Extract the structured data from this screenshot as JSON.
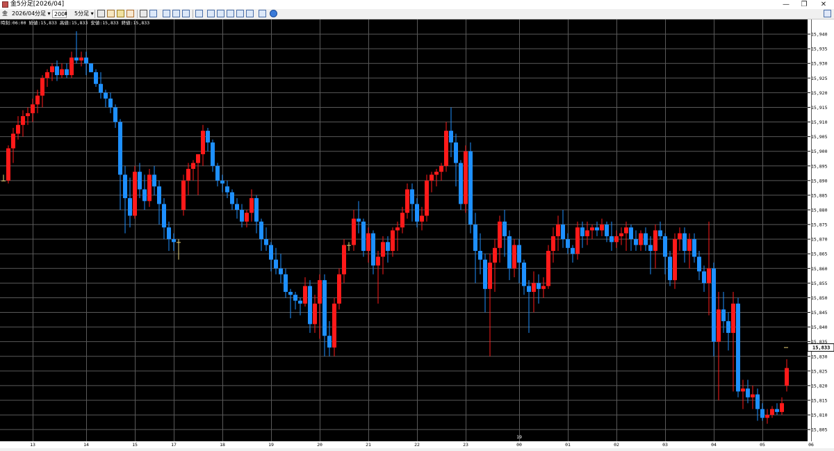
{
  "window": {
    "title": "金5分足[2026/04]",
    "controls": [
      "—",
      "❐",
      "✕"
    ]
  },
  "toolbar": {
    "symbol": "金",
    "contract": "2026/04",
    "period_unit": "分足",
    "bar_count": "200",
    "timeframe": "5分足",
    "icons": [
      "cursor-icon",
      "hand-icon",
      "pencil-icon",
      "line-icon",
      "crosshair-icon",
      "window-icon",
      "grid-icon",
      "table-icon",
      "indicator-icon",
      "bar-chart-icon",
      "bar-chart2-icon",
      "bar-chart3-icon",
      "bar-chart4-icon",
      "bar-chart5-icon",
      "refresh-icon",
      "settings-icon"
    ]
  },
  "info": {
    "time_label": "時刻:",
    "time": "06:00",
    "open_label": "始値:",
    "open": "15,833",
    "high_label": "高値:",
    "high": "15,833",
    "low_label": "安値:",
    "low": "15,833",
    "close_label": "終値:",
    "close": "15,833"
  },
  "colors": {
    "background": "#000000",
    "grid": "#5a5a5a",
    "up": "#ff1a1a",
    "down": "#1e90ff",
    "doji": "#e8d27a",
    "axis_bg": "#ffffff"
  },
  "chart_data": {
    "type": "candlestick",
    "y_range": [
      15801,
      15945
    ],
    "y_ticks": [
      15805,
      15810,
      15815,
      15820,
      15825,
      15830,
      15835,
      15840,
      15845,
      15850,
      15855,
      15860,
      15865,
      15870,
      15875,
      15880,
      15885,
      15890,
      15895,
      15900,
      15905,
      15910,
      15915,
      15920,
      15925,
      15930,
      15935,
      15940
    ],
    "current_price": 15833,
    "current_price_label": "15,833",
    "x_labels": [
      {
        "label": "13",
        "index": 6
      },
      {
        "label": "14",
        "index": 17
      },
      {
        "label": "15",
        "index": 27
      },
      {
        "label": "17",
        "index": 35
      },
      {
        "label": "18",
        "index": 45
      },
      {
        "label": "19",
        "index": 55
      },
      {
        "label": "20",
        "index": 65
      },
      {
        "label": "21",
        "index": 75
      },
      {
        "label": "22",
        "index": 85
      },
      {
        "label": "23",
        "index": 95
      },
      {
        "label": "00",
        "index": 106
      },
      {
        "label": "01",
        "index": 116
      },
      {
        "label": "02",
        "index": 126
      },
      {
        "label": "03",
        "index": 136
      },
      {
        "label": "04",
        "index": 146
      },
      {
        "label": "05",
        "index": 156
      },
      {
        "label": "06",
        "index": 166
      }
    ],
    "x_sublabel": {
      "label": "19",
      "index": 106
    },
    "candles": [
      [
        15890,
        15892,
        15890,
        15890
      ],
      [
        15890,
        15902,
        15889,
        15901
      ],
      [
        15901,
        15908,
        15896,
        15906
      ],
      [
        15906,
        15912,
        15904,
        15909
      ],
      [
        15909,
        15914,
        15905,
        15912
      ],
      [
        15912,
        15915,
        15909,
        15913
      ],
      [
        15913,
        15918,
        15910,
        15916
      ],
      [
        15916,
        15921,
        15913,
        15919
      ],
      [
        15919,
        15926,
        15915,
        15925
      ],
      [
        15925,
        15928,
        15922,
        15927
      ],
      [
        15927,
        15930,
        15924,
        15929
      ],
      [
        15929,
        15931,
        15924,
        15926
      ],
      [
        15926,
        15930,
        15925,
        15928
      ],
      [
        15928,
        15930,
        15925,
        15926
      ],
      [
        15926,
        15934,
        15925,
        15932
      ],
      [
        15932,
        15941,
        15930,
        15931
      ],
      [
        15931,
        15934,
        15929,
        15932
      ],
      [
        15932,
        15934,
        15926,
        15930
      ],
      [
        15930,
        15930,
        15927,
        15927
      ],
      [
        15927,
        15928,
        15922,
        15923
      ],
      [
        15923,
        15927,
        15918,
        15920
      ],
      [
        15920,
        15921,
        15915,
        15918
      ],
      [
        15918,
        15920,
        15913,
        15915
      ],
      [
        15915,
        15916,
        15908,
        15910
      ],
      [
        15910,
        15911,
        15880,
        15892
      ],
      [
        15892,
        15895,
        15872,
        15884
      ],
      [
        15884,
        15891,
        15874,
        15878
      ],
      [
        15878,
        15895,
        15877,
        15893
      ],
      [
        15893,
        15896,
        15884,
        15887
      ],
      [
        15887,
        15892,
        15880,
        15883
      ],
      [
        15883,
        15894,
        15881,
        15892
      ],
      [
        15892,
        15895,
        15885,
        15888
      ],
      [
        15888,
        15890,
        15875,
        15882
      ],
      [
        15882,
        15884,
        15870,
        15874
      ],
      [
        15874,
        15876,
        15866,
        15870
      ],
      [
        15870,
        15872,
        15866,
        15869
      ],
      [
        15869,
        15870,
        15863,
        15869
      ],
      [
        15880,
        15892,
        15878,
        15890
      ],
      [
        15890,
        15896,
        15885,
        15894
      ],
      [
        15894,
        15897,
        15890,
        15896
      ],
      [
        15896,
        15899,
        15885,
        15899
      ],
      [
        15899,
        15909,
        15895,
        15907
      ],
      [
        15907,
        15908,
        15900,
        15903
      ],
      [
        15903,
        15904,
        15893,
        15895
      ],
      [
        15895,
        15896,
        15888,
        15890
      ],
      [
        15890,
        15892,
        15886,
        15889
      ],
      [
        15888,
        15890,
        15884,
        15886
      ],
      [
        15886,
        15887,
        15880,
        15882
      ],
      [
        15882,
        15884,
        15877,
        15880
      ],
      [
        15880,
        15882,
        15874,
        15876
      ],
      [
        15876,
        15880,
        15874,
        15879
      ],
      [
        15879,
        15887,
        15876,
        15884
      ],
      [
        15884,
        15885,
        15872,
        15876
      ],
      [
        15876,
        15877,
        15866,
        15870
      ],
      [
        15870,
        15874,
        15866,
        15868
      ],
      [
        15868,
        15869,
        15859,
        15863
      ],
      [
        15863,
        15867,
        15858,
        15860
      ],
      [
        15860,
        15865,
        15855,
        15858
      ],
      [
        15858,
        15860,
        15850,
        15852
      ],
      [
        15852,
        15853,
        15843,
        15851
      ],
      [
        15851,
        15852,
        15846,
        15849
      ],
      [
        15849,
        15850,
        15844,
        15848
      ],
      [
        15848,
        15857,
        15847,
        15854
      ],
      [
        15854,
        15856,
        15838,
        15841
      ],
      [
        15841,
        15851,
        15838,
        15848
      ],
      [
        15848,
        15858,
        15836,
        15856
      ],
      [
        15856,
        15858,
        15830,
        15837
      ],
      [
        15837,
        15842,
        15830,
        15833
      ],
      [
        15833,
        15850,
        15830,
        15848
      ],
      [
        15848,
        15860,
        15846,
        15858
      ],
      [
        15858,
        15870,
        15855,
        15868
      ],
      [
        15868,
        15869,
        15866,
        15868
      ],
      [
        15868,
        15880,
        15866,
        15877
      ],
      [
        15877,
        15883,
        15872,
        15876
      ],
      [
        15876,
        15877,
        15864,
        15866
      ],
      [
        15866,
        15874,
        15862,
        15872
      ],
      [
        15872,
        15873,
        15858,
        15861
      ],
      [
        15861,
        15866,
        15848,
        15864
      ],
      [
        15864,
        15871,
        15858,
        15869
      ],
      [
        15869,
        15871,
        15862,
        15866
      ],
      [
        15866,
        15874,
        15864,
        15873
      ],
      [
        15873,
        15876,
        15866,
        15874
      ],
      [
        15874,
        15881,
        15872,
        15879
      ],
      [
        15879,
        15889,
        15877,
        15887
      ],
      [
        15887,
        15889,
        15876,
        15882
      ],
      [
        15882,
        15884,
        15874,
        15876
      ],
      [
        15876,
        15881,
        15873,
        15878
      ],
      [
        15878,
        15892,
        15876,
        15890
      ],
      [
        15890,
        15893,
        15886,
        15892
      ],
      [
        15892,
        15894,
        15888,
        15893
      ],
      [
        15893,
        15896,
        15890,
        15895
      ],
      [
        15895,
        15910,
        15893,
        15907
      ],
      [
        15907,
        15915,
        15898,
        15903
      ],
      [
        15903,
        15906,
        15888,
        15896
      ],
      [
        15896,
        15897,
        15880,
        15882
      ],
      [
        15882,
        15902,
        15879,
        15900
      ],
      [
        15900,
        15903,
        15872,
        15875
      ],
      [
        15875,
        15879,
        15855,
        15866
      ],
      [
        15866,
        15872,
        15858,
        15863
      ],
      [
        15863,
        15865,
        15845,
        15853
      ],
      [
        15853,
        15865,
        15830,
        15862
      ],
      [
        15862,
        15870,
        15852,
        15867
      ],
      [
        15867,
        15878,
        15862,
        15876
      ],
      [
        15876,
        15880,
        15864,
        15871
      ],
      [
        15871,
        15873,
        15856,
        15860
      ],
      [
        15860,
        15870,
        15857,
        15868
      ],
      [
        15868,
        15870,
        15855,
        15862
      ],
      [
        15862,
        15863,
        15851,
        15854
      ],
      [
        15854,
        15856,
        15838,
        15852
      ],
      [
        15852,
        15859,
        15845,
        15855
      ],
      [
        15855,
        15858,
        15848,
        15853
      ],
      [
        15853,
        15857,
        15850,
        15854
      ],
      [
        15854,
        15868,
        15853,
        15866
      ],
      [
        15866,
        15874,
        15862,
        15871
      ],
      [
        15871,
        15878,
        15866,
        15875
      ],
      [
        15875,
        15880,
        15867,
        15870
      ],
      [
        15870,
        15872,
        15865,
        15867
      ],
      [
        15867,
        15868,
        15862,
        15865
      ],
      [
        15865,
        15876,
        15863,
        15874
      ],
      [
        15874,
        15876,
        15867,
        15871
      ],
      [
        15871,
        15876,
        15868,
        15873
      ],
      [
        15873,
        15875,
        15870,
        15874
      ],
      [
        15874,
        15876,
        15871,
        15873
      ],
      [
        15873,
        15877,
        15871,
        15875
      ],
      [
        15875,
        15876,
        15869,
        15871
      ],
      [
        15871,
        15876,
        15866,
        15869
      ],
      [
        15869,
        15873,
        15867,
        15871
      ],
      [
        15871,
        15874,
        15868,
        15872
      ],
      [
        15872,
        15876,
        15866,
        15874
      ],
      [
        15874,
        15875,
        15866,
        15870
      ],
      [
        15870,
        15873,
        15866,
        15868
      ],
      [
        15868,
        15873,
        15866,
        15872
      ],
      [
        15872,
        15874,
        15866,
        15868
      ],
      [
        15868,
        15871,
        15858,
        15866
      ],
      [
        15866,
        15875,
        15860,
        15873
      ],
      [
        15873,
        15876,
        15870,
        15871
      ],
      [
        15871,
        15872,
        15858,
        15864
      ],
      [
        15864,
        15866,
        15854,
        15856
      ],
      [
        15856,
        15872,
        15853,
        15870
      ],
      [
        15870,
        15874,
        15866,
        15872
      ],
      [
        15872,
        15874,
        15862,
        15866
      ],
      [
        15866,
        15872,
        15860,
        15870
      ],
      [
        15870,
        15872,
        15862,
        15864
      ],
      [
        15864,
        15866,
        15856,
        15859
      ],
      [
        15859,
        15861,
        15852,
        15855
      ],
      [
        15855,
        15876,
        15844,
        15860
      ],
      [
        15860,
        15862,
        15830,
        15835
      ],
      [
        15835,
        15852,
        15815,
        15846
      ],
      [
        15846,
        15852,
        15838,
        15842
      ],
      [
        15842,
        15845,
        15832,
        15838
      ],
      [
        15838,
        15852,
        15818,
        15848
      ],
      [
        15848,
        15850,
        15816,
        15818
      ],
      [
        15818,
        15822,
        15812,
        15819
      ],
      [
        15819,
        15822,
        15814,
        15816
      ],
      [
        15816,
        15820,
        15812,
        15817
      ],
      [
        15817,
        15819,
        15808,
        15812
      ],
      [
        15812,
        15814,
        15808,
        15809
      ],
      [
        15809,
        15812,
        15807,
        15810
      ],
      [
        15810,
        15813,
        15809,
        15812
      ],
      [
        15812,
        15814,
        15810,
        15811
      ],
      [
        15811,
        15816,
        15810,
        15814
      ],
      [
        15820,
        15829,
        15818,
        15826
      ]
    ]
  }
}
